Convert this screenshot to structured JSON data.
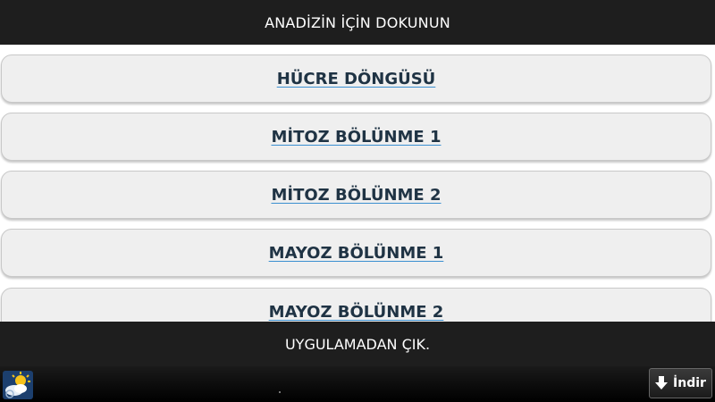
{
  "header": {
    "title": "ANADİZİN İÇİN DOKUNUN"
  },
  "menu": {
    "items": [
      {
        "label": "HÜCRE DÖNGÜSÜ"
      },
      {
        "label": "MİTOZ BÖLÜNME 1"
      },
      {
        "label": "MİTOZ BÖLÜNME 2"
      },
      {
        "label": "MAYOZ BÖLÜNME 1"
      },
      {
        "label": "MAYOZ BÖLÜNME 2"
      }
    ]
  },
  "footer": {
    "exit_label": "UYGULAMADAN ÇIK."
  },
  "ad_banner": {
    "icon": "weather-sun-cloud-icon",
    "download_icon": "download-arrow-icon",
    "download_label": "İndir"
  },
  "colors": {
    "bar_background": "#1e1e1e",
    "item_background": "#efefef",
    "item_text": "#1f3344",
    "underline_accent": "#3a8fd0"
  }
}
